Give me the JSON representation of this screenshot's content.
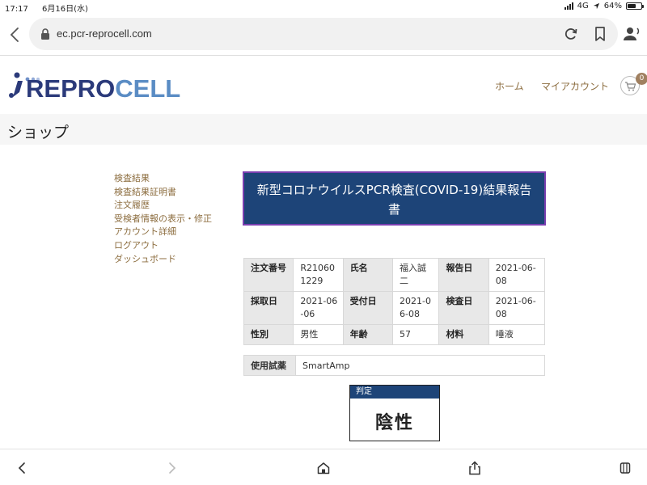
{
  "status_bar": {
    "time": "17:17",
    "date": "6月16日(水)",
    "network": "4G",
    "battery": "64%",
    "battery_level": 0.64
  },
  "browser": {
    "url": "ec.pcr-reprocell.com"
  },
  "site": {
    "logo_text_main": "REPRO",
    "logo_text_accent": "CELL",
    "nav": {
      "home": "ホーム",
      "my_account": "マイアカウント"
    },
    "cart_count": "0"
  },
  "page": {
    "title": "ショップ"
  },
  "sidebar": {
    "items": [
      {
        "label": "検査結果"
      },
      {
        "label": "検査結果証明書"
      },
      {
        "label": "注文履歴"
      },
      {
        "label": "受検者情報の表示・修正"
      },
      {
        "label": "アカウント詳細"
      },
      {
        "label": "ログアウト"
      },
      {
        "label": "ダッシュボード"
      }
    ]
  },
  "report": {
    "title": "新型コロナウイルスPCR検査(COVID-19)結果報告書",
    "rows": [
      [
        {
          "label": "注文番号",
          "value": "R210601229"
        },
        {
          "label": "氏名",
          "value": "福入誠二"
        },
        {
          "label": "報告日",
          "value": "2021-06-08"
        }
      ],
      [
        {
          "label": "採取日",
          "value": "2021-06-06"
        },
        {
          "label": "受付日",
          "value": "2021-06-08"
        },
        {
          "label": "検査日",
          "value": "2021-06-08"
        }
      ],
      [
        {
          "label": "性別",
          "value": "男性"
        },
        {
          "label": "年齢",
          "value": "57"
        },
        {
          "label": "材料",
          "value": "唾液"
        }
      ]
    ],
    "reagent": {
      "label": "使用試薬",
      "value": "SmartAmp"
    },
    "judgment": {
      "label": "判定",
      "value": "陰性"
    }
  },
  "colors": {
    "brand_navy": "#1d4478",
    "title_border": "#7a3fb0",
    "link_brown": "#8c6d3f"
  }
}
